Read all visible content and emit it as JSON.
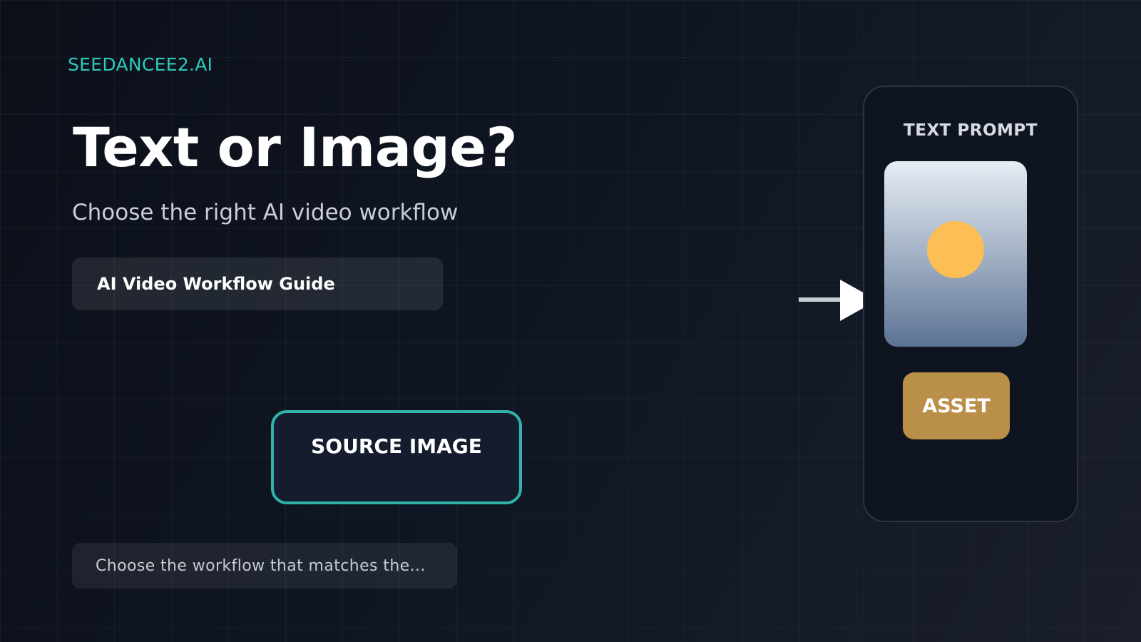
{
  "brand": {
    "name": "SEEDANCEE2.AI"
  },
  "hero": {
    "title": "Text or Image?",
    "subtitle": "Choose the right AI video workflow"
  },
  "guide_pill": {
    "label": "AI Video Workflow Guide"
  },
  "source_box": {
    "label": "SOURCE IMAGE"
  },
  "note": {
    "text": "Choose the workflow that matches the..."
  },
  "card": {
    "label": "TEXT PROMPT",
    "button_label": "ASSET"
  },
  "icons": {
    "arrow": "arrow-right-icon",
    "preview": "image-preview-icon",
    "sun": "sun-icon"
  },
  "colors": {
    "accent_teal": "#2ec9bd",
    "box_border": "#2fb3aa",
    "asset_gold": "#ba8f49",
    "sun_yellow": "#fdbe55",
    "background": "#0c111b"
  }
}
